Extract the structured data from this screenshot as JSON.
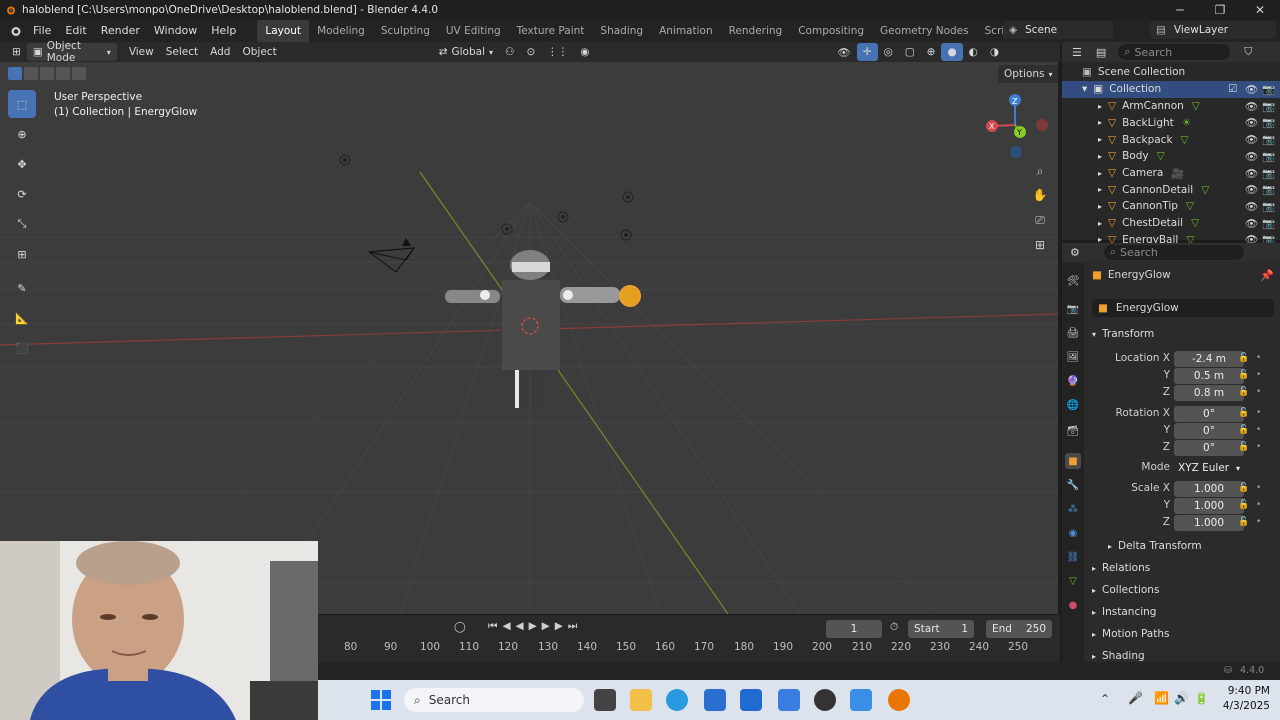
{
  "window": {
    "title": "haloblend [C:\\Users\\monpo\\OneDrive\\Desktop\\haloblend.blend] - Blender 4.4.0",
    "minimize": "─",
    "maximize": "❐",
    "close": "✕"
  },
  "menu": [
    "File",
    "Edit",
    "Render",
    "Window",
    "Help"
  ],
  "workspaces": [
    "Layout",
    "Modeling",
    "Sculpting",
    "UV Editing",
    "Texture Paint",
    "Shading",
    "Animation",
    "Rendering",
    "Compositing",
    "Geometry Nodes",
    "Scripting"
  ],
  "add_workspace": "+",
  "scene": {
    "label": "Scene"
  },
  "view_layer": {
    "label": "ViewLayer"
  },
  "viewport_header": {
    "mode": "Object Mode",
    "menus": [
      "View",
      "Select",
      "Add",
      "Object"
    ],
    "orientation": "Global",
    "options": "Options"
  },
  "viewport": {
    "perspective_label": "User Perspective",
    "context_label": "(1) Collection | EnergyGlow",
    "gizmo": {
      "x": "X",
      "y": "Y",
      "z": "Z"
    }
  },
  "timeline": {
    "current_frame": "1",
    "start_label": "Start",
    "start_value": "1",
    "end_label": "End",
    "end_value": "250",
    "ruler": [
      "80",
      "90",
      "100",
      "110",
      "120",
      "130",
      "140",
      "150",
      "160",
      "170",
      "180",
      "190",
      "200",
      "210",
      "220",
      "230",
      "240",
      "250"
    ]
  },
  "outliner": {
    "search_placeholder": "Search",
    "scene_collection": "Scene Collection",
    "collection": "Collection",
    "items": [
      {
        "name": "ArmCannon",
        "type": "mesh"
      },
      {
        "name": "BackLight",
        "type": "light"
      },
      {
        "name": "Backpack",
        "type": "mesh"
      },
      {
        "name": "Body",
        "type": "mesh"
      },
      {
        "name": "Camera",
        "type": "camera"
      },
      {
        "name": "CannonDetail",
        "type": "mesh"
      },
      {
        "name": "CannonTip",
        "type": "mesh"
      },
      {
        "name": "ChestDetail",
        "type": "mesh"
      },
      {
        "name": "EnergyBall",
        "type": "mesh"
      }
    ]
  },
  "properties": {
    "search_placeholder": "Search",
    "object_name": "EnergyGlow",
    "datablock_name": "EnergyGlow",
    "transform_label": "Transform",
    "location_label": "Location X",
    "location": {
      "x": "-2.4 m",
      "y": "0.5 m",
      "z": "0.8 m"
    },
    "rotation_label": "Rotation X",
    "rotation": {
      "x": "0°",
      "y": "0°",
      "z": "0°"
    },
    "mode_label": "Mode",
    "mode_value": "XYZ Euler",
    "scale_label": "Scale X",
    "scale": {
      "x": "1.000",
      "y": "1.000",
      "z": "1.000"
    },
    "axis_y": "Y",
    "axis_z": "Z",
    "panels": [
      "Delta Transform",
      "Relations",
      "Collections",
      "Instancing",
      "Motion Paths",
      "Shading"
    ]
  },
  "statusbar": {
    "version": "4.4.0"
  },
  "taskbar": {
    "search_label": "Search",
    "time": "9:40 PM",
    "date": "4/3/2025"
  },
  "colors": {
    "accent": "#4772b3",
    "x_axis": "#d04a4a",
    "y_axis": "#6fb62a",
    "z_axis": "#3f7fd1",
    "selected": "#f0a030"
  }
}
